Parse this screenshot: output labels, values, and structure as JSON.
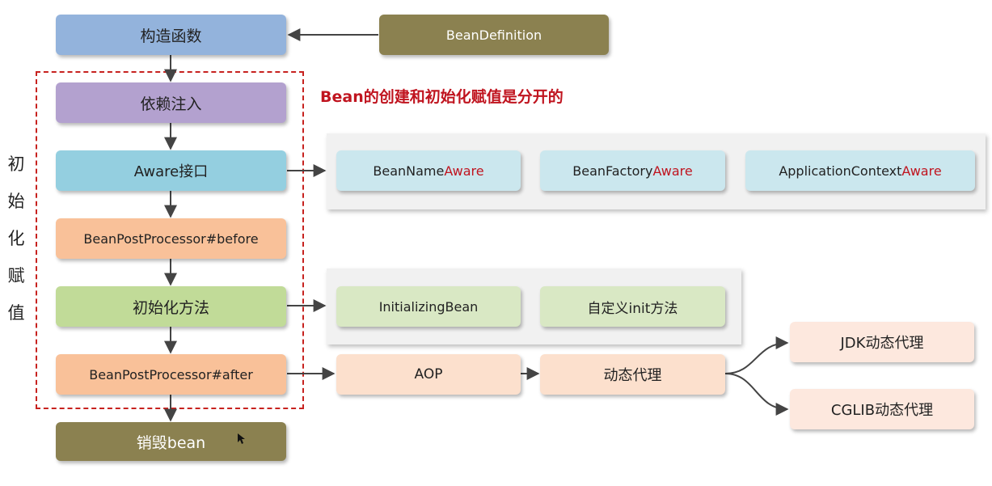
{
  "main_flow": {
    "constructor": "构造函数",
    "dependency_injection": "依赖注入",
    "aware_interface": "Aware接口",
    "post_processor_before": "BeanPostProcessor#before",
    "init_method": "初始化方法",
    "post_processor_after": "BeanPostProcessor#after",
    "destroy_bean": "销毁bean"
  },
  "bean_definition": "BeanDefinition",
  "side_label": [
    "初",
    "始",
    "化",
    "赋",
    "值"
  ],
  "headline": "Bean的创建和初始化赋值是分开的",
  "aware_panel": {
    "items": [
      {
        "prefix": "BeanName",
        "suffix": "Aware"
      },
      {
        "prefix": "BeanFactory",
        "suffix": "Aware"
      },
      {
        "prefix": "ApplicationContext",
        "suffix": "Aware"
      }
    ]
  },
  "init_panel": {
    "items": [
      "InitializingBean",
      "自定义init方法"
    ]
  },
  "aop_flow": {
    "aop": "AOP",
    "dynamic_proxy": "动态代理",
    "jdk_proxy": "JDK动态代理",
    "cglib_proxy": "CGLIB动态代理"
  },
  "colors": {
    "blue": "#93b3dc",
    "olive": "#8b8150",
    "purple": "#b3a1cf",
    "cyan": "#94cfe0",
    "orange": "#f9c199",
    "green": "#c1db98",
    "light_cyan": "#cbe7ee",
    "light_green": "#d9e8c4",
    "peach": "#fce0cd",
    "light_peach": "#fde8de",
    "accent_red": "#c0141f",
    "arrow": "#444444"
  }
}
